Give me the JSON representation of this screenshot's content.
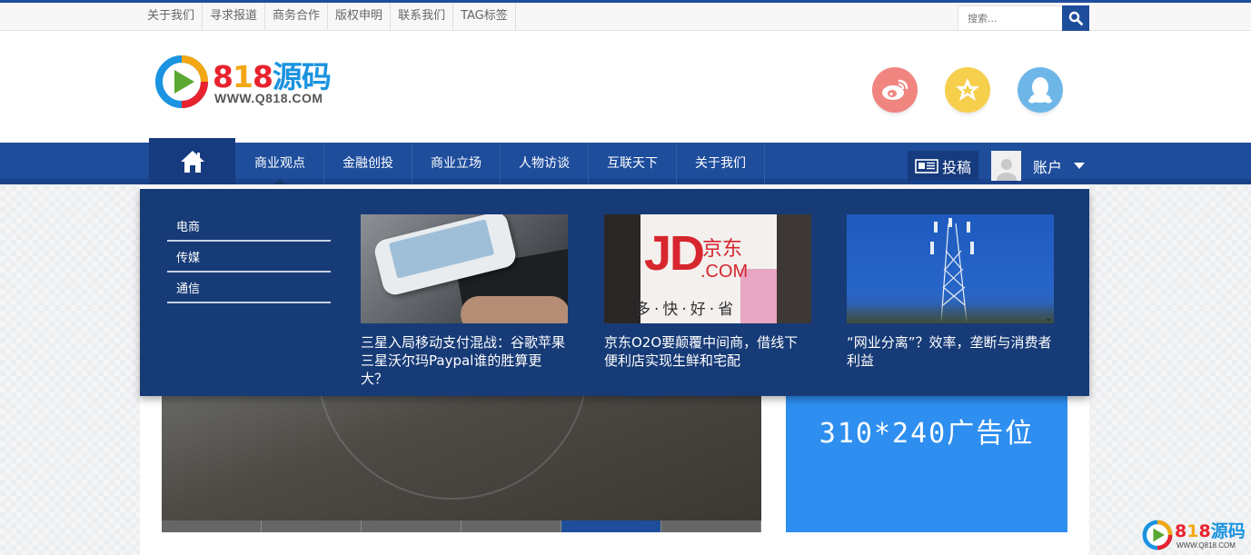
{
  "topbar": {
    "links": [
      "关于我们",
      "寻求报道",
      "商务合作",
      "版权申明",
      "联系我们",
      "TAG标签"
    ],
    "search_placeholder": "搜索..."
  },
  "logo": {
    "digit_1": "8",
    "digit_2": "1",
    "digit_3": "8",
    "chinese": "源码",
    "url": "WWW.Q818.COM"
  },
  "social": [
    "weibo-icon",
    "star-icon",
    "qq-icon"
  ],
  "nav": {
    "items": [
      "商业观点",
      "金融创投",
      "商业立场",
      "人物访谈",
      "互联天下",
      "关于我们"
    ],
    "active": "商业观点",
    "contribute_label": "投稿",
    "account_label": "账户"
  },
  "dropdown": {
    "sub_categories": [
      "电商",
      "传媒",
      "通信"
    ],
    "cards": [
      {
        "title": "三星入局移动支付混战：谷歌苹果三星沃尔玛Paypal谁的胜算更大？"
      },
      {
        "title": "京东O2O要颠覆中间商，借线下便利店实现生鲜和宅配",
        "img_text": "JD",
        "img_text_cn": "京东",
        "img_text_com": ".COM",
        "img_slogan": "多·快·好·省"
      },
      {
        "title": "“网业分离”？效率，垄断与消费者利益"
      }
    ]
  },
  "ad": {
    "label": "310*240广告位"
  },
  "slider": {
    "segments": 6,
    "active_index": 4
  },
  "colors": {
    "primary": "#1e4d9c",
    "dropdown_bg": "#173b77",
    "ad_bg": "#2e8ff0"
  }
}
